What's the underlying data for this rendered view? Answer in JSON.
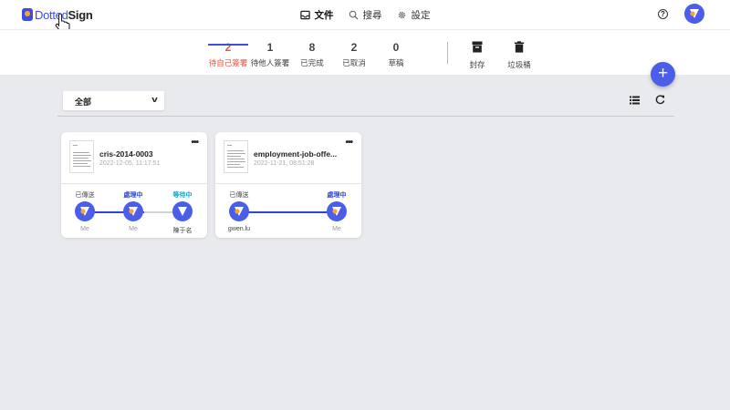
{
  "app": {
    "logo_part1": "Dotted",
    "logo_part2": "Sign"
  },
  "nav": {
    "documents": "文件",
    "search": "搜尋",
    "settings": "設定"
  },
  "help_label": "?",
  "status_tabs": [
    {
      "count": "2",
      "label": "待自己簽署",
      "active": true
    },
    {
      "count": "1",
      "label": "待他人簽署"
    },
    {
      "count": "8",
      "label": "已完成"
    },
    {
      "count": "2",
      "label": "已取消"
    },
    {
      "count": "0",
      "label": "草稿"
    }
  ],
  "archive_tabs": [
    {
      "label": "封存",
      "icon": "archive-icon"
    },
    {
      "label": "垃圾桶",
      "icon": "trash-icon"
    }
  ],
  "fab_label": "+",
  "filter": {
    "selected": "全部",
    "chevron": "v"
  },
  "cards": [
    {
      "title": "cris-2014-0003",
      "date": "2022-12-05, 11:17:51",
      "more": "•••",
      "steps": [
        {
          "status": "已傳送",
          "name": "Me"
        },
        {
          "status": "處理中",
          "name": "Me"
        },
        {
          "status": "等待中",
          "name": "陳于名"
        }
      ]
    },
    {
      "title": "employment-job-offe...",
      "date": "2022-11-21, 08:51:28",
      "more": "•••",
      "steps": [
        {
          "status": "已傳送",
          "name": "gwen.lu"
        },
        {
          "status": "處理中",
          "name": "Me"
        }
      ]
    }
  ],
  "colors": {
    "accent": "#4a5ee8",
    "active_tab": "#e8533f",
    "processing": "#2f44d0",
    "waiting": "#1aa3c8",
    "avatar_orange": "#f4a532"
  }
}
